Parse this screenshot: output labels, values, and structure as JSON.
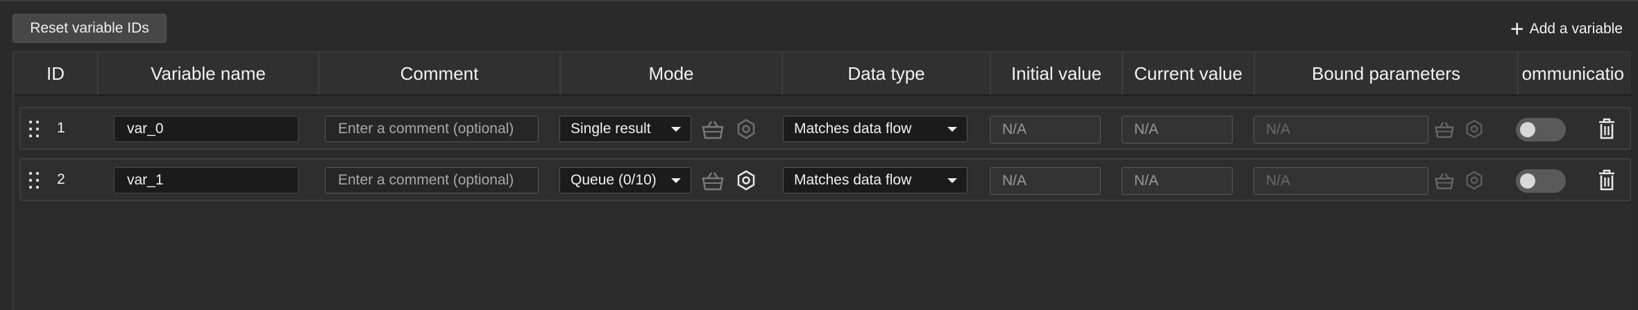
{
  "toolbar": {
    "reset_label": "Reset variable IDs",
    "add_label": "Add a variable"
  },
  "columns": [
    {
      "key": "id",
      "label": "ID"
    },
    {
      "key": "name",
      "label": "Variable name"
    },
    {
      "key": "comment",
      "label": "Comment"
    },
    {
      "key": "mode",
      "label": "Mode"
    },
    {
      "key": "data_type",
      "label": "Data type"
    },
    {
      "key": "initial",
      "label": "Initial value"
    },
    {
      "key": "current",
      "label": "Current value"
    },
    {
      "key": "bound",
      "label": "Bound parameters"
    },
    {
      "key": "comm",
      "label": "ommunicatio"
    }
  ],
  "rows": [
    {
      "id": "1",
      "name": "var_0",
      "comment_placeholder": "Enter a comment (optional)",
      "mode": "Single result",
      "data_type": "Matches data flow",
      "initial": "N/A",
      "current": "N/A",
      "bound": "N/A",
      "communication_on": false
    },
    {
      "id": "2",
      "name": "var_1",
      "comment_placeholder": "Enter a comment (optional)",
      "mode": "Queue (0/10)",
      "data_type": "Matches data flow",
      "initial": "N/A",
      "current": "N/A",
      "bound": "N/A",
      "communication_on": false
    }
  ],
  "icons": {
    "drag": "drag-handle-icon",
    "basket": "basket-icon",
    "settings": "hex-settings-icon",
    "delete": "trash-icon",
    "add": "plus-icon"
  }
}
